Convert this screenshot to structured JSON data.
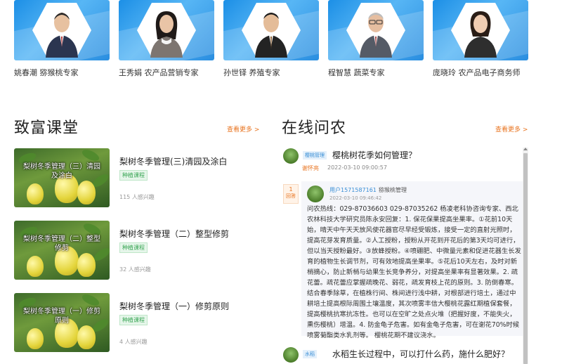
{
  "experts": [
    {
      "name": "姚春潮 猕猴桃专家"
    },
    {
      "name": "王秀娟 农产品营销专家"
    },
    {
      "name": "孙世铎 养殖专家"
    },
    {
      "name": "程智慧 蔬菜专家"
    },
    {
      "name": "庞晓玲 农产品电子商务师"
    }
  ],
  "courses_section": {
    "title": "致富课堂",
    "more": "查看更多 >",
    "items": [
      {
        "thumb_title": "梨树冬季管理（三）清园及涂白",
        "title": "梨树冬季管理(三)清园及涂白",
        "tag": "种植课程",
        "interest": "115 人感兴趣"
      },
      {
        "thumb_title": "梨树冬季管理（二）整型修剪",
        "title": "梨树冬季管理（二）整型修剪",
        "tag": "种植课程",
        "interest": "32 人感兴趣"
      },
      {
        "thumb_title": "梨树冬季管理（一）修剪原则",
        "title": "梨树冬季管理（一）修剪原则",
        "tag": "种植课程",
        "interest": "4 人感兴趣"
      }
    ]
  },
  "qa_section": {
    "title": "在线问农",
    "more": "查看更多 >",
    "questions": [
      {
        "tag": "樱桃管理",
        "title": "樱桃树花季如何管理？",
        "author": "谢怀亮",
        "date": "2022-03-10 09:00:57",
        "answer_count": "1",
        "answer_label": "回答",
        "answer": {
          "user": "用户1571587161",
          "category": "猕猴桃管理",
          "date": "2022-03-10 09:46:42",
          "text": "问农热线：029-87036603 029-87035262 杨凌老科协咨询专家、西北农林科技大学研究员陈永安回复：1. 保花保果提高坐果率。①花前10天始，晴天中午天天放风使花器官尽早经受锻炼，接受一定的直射光照时，提高花芽发育质量。②人工授粉，授粉从开花到开花后的第3天均可进行，但以当天授粉最好。③放蜂授粉。④喷硼肥、中微量元素和促进花器生长发育的植物生长调节剂，可有效地提高坐果率。⑤花后10天左右，及时对新梢摘心，防止新梢与幼果生长竞争养分，对提高坐果率有显著效果。2. 疏花蕾。疏花蕾应掌握疏晚花、弱花，疏发育枝上花的原则。3. 防倒春寒。结合春季除草，在植株行间、株间进行浅中耕，对根部进行培土，通过中耕培土提高根际周围土壤温度，其次喷雾丰信大樱桃花露红期植保套餐，提高樱桃抗寒抗冻性。也可以在空旷之处点火堆（把握好度，不能失火，熏伤樱桃）增温。4. 防金龟子危害。如有金龟子危害，可在谢花70%时候喷雾菊酯类水乳剂等。 樱桃花期不建议浇水。"
        }
      },
      {
        "tag": "水稻",
        "title": "水稻生长过程中，可以打什么药，施什么肥好？"
      }
    ]
  },
  "colors": {
    "accent": "#e8731f",
    "link_blue": "#3a8fd6",
    "tag_green": "#3aa655"
  }
}
